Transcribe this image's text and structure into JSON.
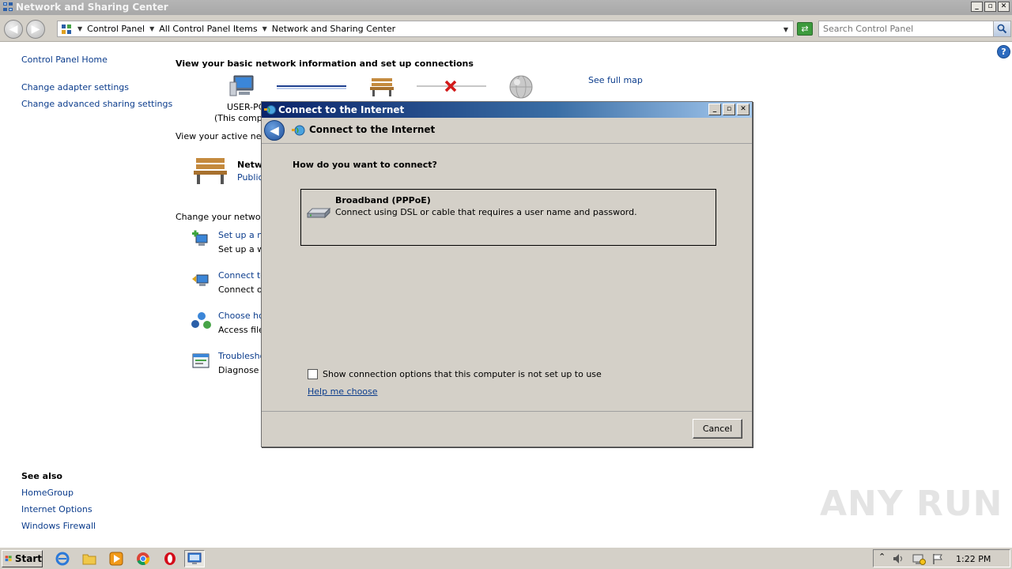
{
  "window": {
    "title": "Network and Sharing Center",
    "min_label": "_",
    "max_label": "▫",
    "close_label": "✕"
  },
  "address": {
    "crumbs": [
      "Control Panel",
      "All Control Panel Items",
      "Network and Sharing Center"
    ],
    "search_placeholder": "Search Control Panel"
  },
  "left_pane": {
    "home": "Control Panel Home",
    "links": [
      "Change adapter settings",
      "Change advanced sharing settings"
    ],
    "see_also_title": "See also",
    "see_also": [
      "HomeGroup",
      "Internet Options",
      "Windows Firewall"
    ]
  },
  "main": {
    "heading": "View your basic network information and set up connections",
    "see_full_map": "See full map",
    "computer_name": "USER-PC",
    "computer_sub": "(This compu",
    "active_networks_label": "View your active netw",
    "network_name": "Netw",
    "network_type": "Public",
    "change_settings_label": "Change your networki",
    "tasks": [
      {
        "link": "Set up a ne",
        "desc": "Set up a wi"
      },
      {
        "link": "Connect to",
        "desc": "Connect or"
      },
      {
        "link": "Choose hor",
        "desc": "Access files"
      },
      {
        "link": "Troublesho",
        "desc": "Diagnose a"
      }
    ]
  },
  "dialog": {
    "title": "Connect to the Internet",
    "header_title": "Connect to the Internet",
    "question": "How do you want to connect?",
    "option": {
      "title": "Broadband (PPPoE)",
      "description": "Connect using DSL or cable that requires a user name and password."
    },
    "checkbox_label": "Show connection options that this computer is not set up to use",
    "checkbox_checked": false,
    "help_link": "Help me choose",
    "cancel_label": "Cancel"
  },
  "watermark": "ANY RUN",
  "taskbar": {
    "start_label": "Start",
    "clock": "1:22 PM"
  }
}
